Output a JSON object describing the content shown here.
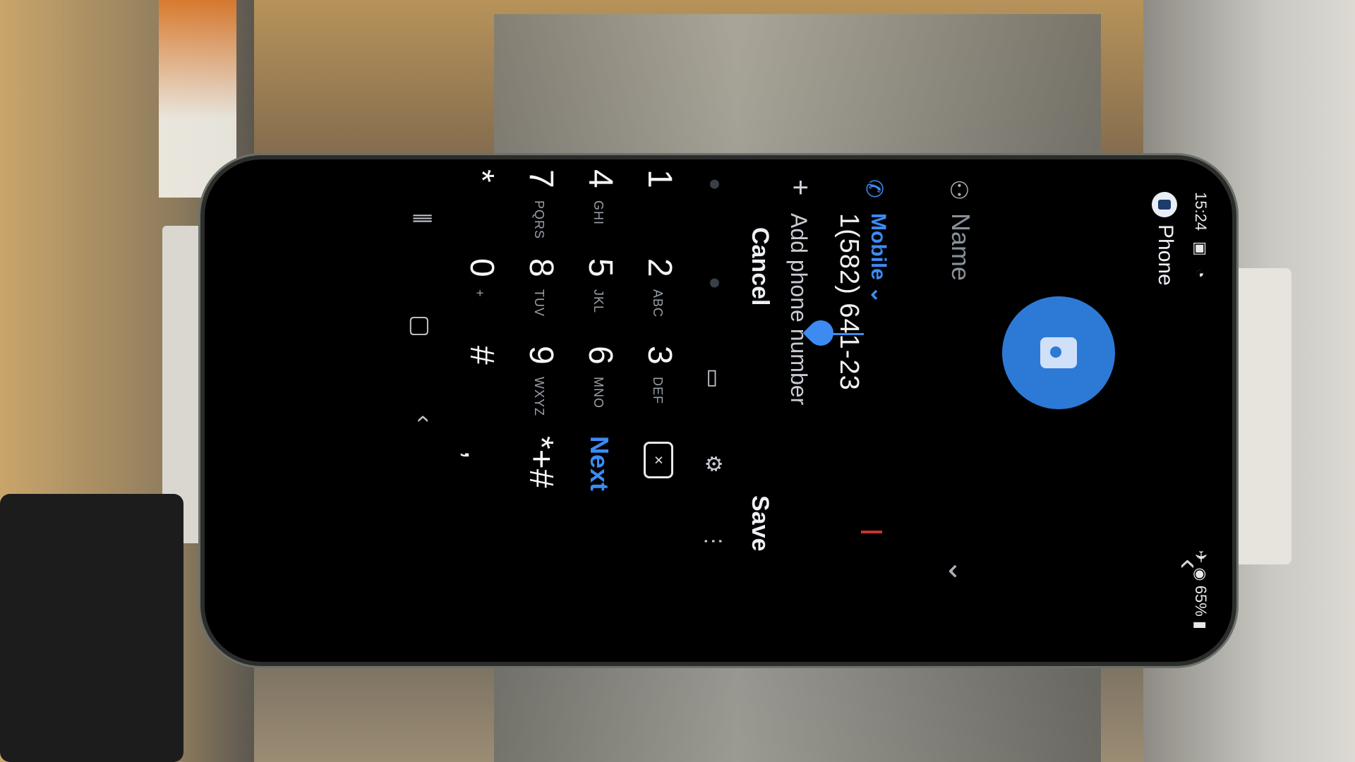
{
  "status_bar": {
    "time": "15:24",
    "icons_left": "▣ ◔",
    "right": "65%"
  },
  "app": {
    "name": "Phone"
  },
  "contact": {
    "name_placeholder": "Name",
    "number_label": "Mobile ⌄",
    "number_value": "1(582) 641-23",
    "add_phone": "Add phone number"
  },
  "actions": {
    "cancel": "Cancel",
    "save": "Save"
  },
  "keypad": {
    "keys": [
      {
        "num": "1",
        "letters": ""
      },
      {
        "num": "2",
        "letters": "ABC"
      },
      {
        "num": "3",
        "letters": "DEF"
      },
      {
        "num": "4",
        "letters": "GHI"
      },
      {
        "num": "5",
        "letters": "JKL"
      },
      {
        "num": "6",
        "letters": "MNO"
      },
      {
        "num": "7",
        "letters": "PQRS"
      },
      {
        "num": "8",
        "letters": "TUV"
      },
      {
        "num": "9",
        "letters": "WXYZ"
      },
      {
        "num": "*",
        "letters": ""
      },
      {
        "num": "0",
        "letters": "+"
      },
      {
        "num": "#",
        "letters": ""
      }
    ],
    "next": "Next",
    "symbols": "*+#",
    "comma": ","
  },
  "icons": {
    "back": "chevron-left-icon",
    "person": "person-icon",
    "phone": "phone-icon",
    "plus": "plus-icon",
    "settings": "gear-icon",
    "more": "more-icon",
    "delete": "backspace-icon",
    "keyboard_switch": "keyboard-icon"
  },
  "colors": {
    "accent": "#3d8bf2",
    "background": "#000000"
  }
}
